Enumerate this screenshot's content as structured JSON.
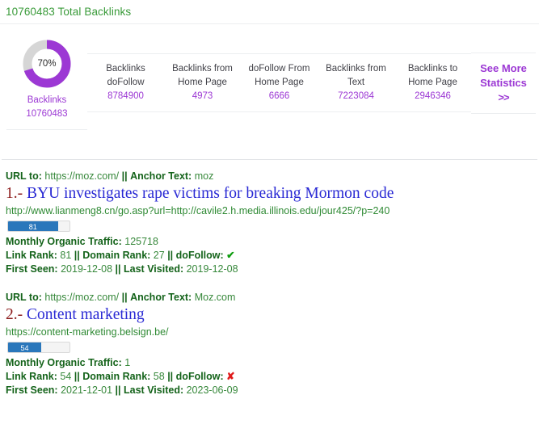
{
  "header": {
    "title": "10760483 Total Backlinks"
  },
  "stats": {
    "donut": {
      "percent_label": "70%",
      "percent_value": 70,
      "label": "Backlinks",
      "value": "10760483",
      "accent_color": "#9c38d4",
      "track_color": "#d6d6d6"
    },
    "cards": [
      {
        "label": "Backlinks doFollow",
        "value": "8784900"
      },
      {
        "label": "Backlinks from Home Page",
        "value": "4973"
      },
      {
        "label": "doFollow From Home Page",
        "value": "6666"
      },
      {
        "label": "Backlinks from Text",
        "value": "7223084"
      },
      {
        "label": "Backlinks to Home Page",
        "value": "2946346"
      }
    ],
    "see_more": {
      "line1": "See More",
      "line2": "Statistics",
      "chevron": ">>"
    }
  },
  "results": [
    {
      "url_to_label": "URL to:",
      "url_to_value": "https://moz.com/",
      "separator": "||",
      "anchor_label": "Anchor Text:",
      "anchor_value": "moz",
      "number": "1.-",
      "title": "BYU investigates rape victims for breaking Mormon code",
      "url": "http://www.lianmeng8.cn/go.asp?url=http://cavile2.h.media.illinois.edu/jour425/?p=240",
      "bar_label": "81",
      "bar_value": 81,
      "traffic_label": "Monthly Organic Traffic:",
      "traffic_value": "125718",
      "link_rank_label": "Link Rank:",
      "link_rank_value": "81",
      "domain_rank_label": "Domain Rank:",
      "domain_rank_value": "27",
      "dofollow_label": "doFollow:",
      "dofollow_icon": "✔",
      "dofollow_state": "yes",
      "first_seen_label": "First Seen:",
      "first_seen_value": "2019-12-08",
      "last_visited_label": "Last Visited:",
      "last_visited_value": "2019-12-08"
    },
    {
      "url_to_label": "URL to:",
      "url_to_value": "https://moz.com/",
      "separator": "||",
      "anchor_label": "Anchor Text:",
      "anchor_value": "Moz.com",
      "number": "2.-",
      "title": "Content marketing",
      "url": "https://content-marketing.belsign.be/",
      "bar_label": "54",
      "bar_value": 54,
      "traffic_label": "Monthly Organic Traffic:",
      "traffic_value": "1",
      "link_rank_label": "Link Rank:",
      "link_rank_value": "54",
      "domain_rank_label": "Domain Rank:",
      "domain_rank_value": "58",
      "dofollow_label": "doFollow:",
      "dofollow_icon": "✘",
      "dofollow_state": "no",
      "first_seen_label": "First Seen:",
      "first_seen_value": "2021-12-01",
      "last_visited_label": "Last Visited:",
      "last_visited_value": "2023-06-09"
    }
  ]
}
